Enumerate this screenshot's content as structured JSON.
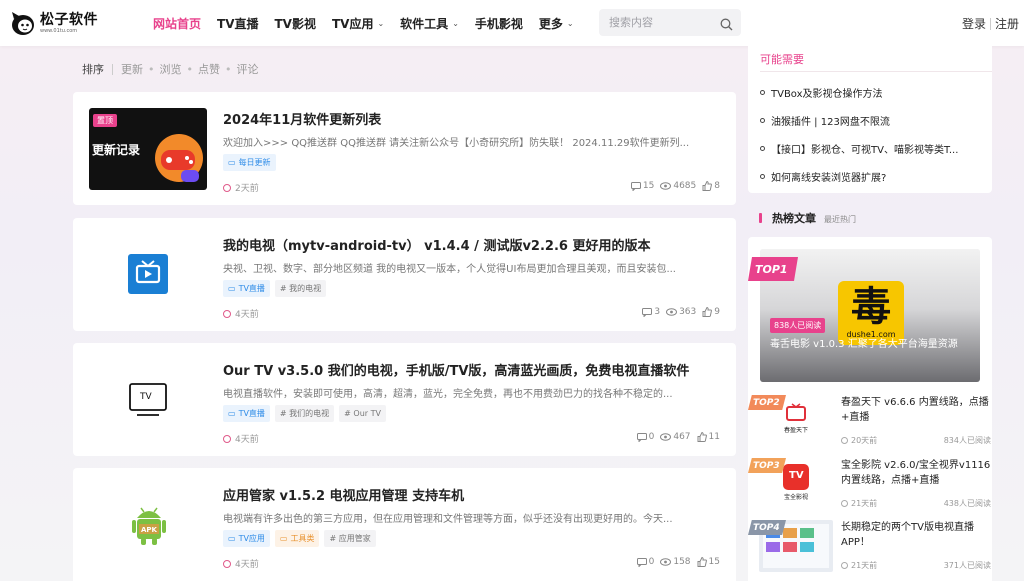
{
  "brand": {
    "name": "松子软件",
    "sub": "www.01tu.com"
  },
  "nav": {
    "items": [
      {
        "label": "网站首页",
        "active": true,
        "has_menu": false
      },
      {
        "label": "TV直播",
        "active": false,
        "has_menu": false
      },
      {
        "label": "TV影视",
        "active": false,
        "has_menu": false
      },
      {
        "label": "TV应用",
        "active": false,
        "has_menu": true
      },
      {
        "label": "软件工具",
        "active": false,
        "has_menu": true
      },
      {
        "label": "手机影视",
        "active": false,
        "has_menu": false
      },
      {
        "label": "更多",
        "active": false,
        "has_menu": true
      }
    ],
    "chevron": "⌄"
  },
  "search": {
    "placeholder": "搜索内容",
    "value": ""
  },
  "auth": {
    "login": "登录",
    "register": "注册"
  },
  "sort": {
    "label": "排序",
    "options": [
      "更新",
      "浏览",
      "点赞",
      "评论"
    ],
    "dot": "•"
  },
  "posts": [
    {
      "title": "2024年11月软件更新列表",
      "excerpt": "欢迎加入>>> QQ推送群 QQ推送群 请关注新公众号【小奇研究所】防失联！ 2024.11.29软件更新列...",
      "tags": [
        {
          "label": "每日更新",
          "style": "blue",
          "icon": "folder-icon"
        }
      ],
      "time": "2天前",
      "comments": "15",
      "views": "4685",
      "likes": "8",
      "thumb": {
        "badge": "置顶",
        "text": "更新记录"
      }
    },
    {
      "title": "我的电视（mytv-android-tv） v1.4.4 / 测试版v2.2.6 更好用的版本",
      "excerpt": "央视、卫视、数字、部分地区频道 我的电视又一版本，个人觉得UI布局更加合理且美观，而且安装包...",
      "tags": [
        {
          "label": "TV直播",
          "style": "blue",
          "icon": "folder-icon"
        },
        {
          "label": "# 我的电视",
          "style": "grey",
          "icon": ""
        }
      ],
      "time": "4天前",
      "comments": "3",
      "views": "363",
      "likes": "9"
    },
    {
      "title": "Our TV v3.5.0 我们的电视，手机版/TV版，高清蓝光画质，免费电视直播软件",
      "excerpt": "电视直播软件，安装即可使用，高清，超清，蓝光，完全免费，再也不用费劲巴力的找各种不稳定的...",
      "tags": [
        {
          "label": "TV直播",
          "style": "blue",
          "icon": "folder-icon"
        },
        {
          "label": "# 我们的电视",
          "style": "grey",
          "icon": ""
        },
        {
          "label": "# Our TV",
          "style": "grey",
          "icon": ""
        }
      ],
      "time": "4天前",
      "comments": "0",
      "views": "467",
      "likes": "11",
      "thumb": {
        "text": "TV"
      }
    },
    {
      "title": "应用管家 v1.5.2 电视应用管理 支持车机",
      "excerpt": "电视端有许多出色的第三方应用，但在应用管理和文件管理等方面，似乎还没有出现更好用的。今天...",
      "tags": [
        {
          "label": "TV应用",
          "style": "blue",
          "icon": "folder-icon"
        },
        {
          "label": "工具类",
          "style": "orange",
          "icon": "folder-icon"
        },
        {
          "label": "# 应用管家",
          "style": "grey",
          "icon": ""
        }
      ],
      "time": "4天前",
      "comments": "0",
      "views": "158",
      "likes": "15",
      "thumb": {
        "text": "APK"
      }
    }
  ],
  "sidebar": {
    "maybe": {
      "title": "可能需要",
      "items": [
        "TVBox及影视仓操作方法",
        "油猴插件 | 123网盘不限流",
        "【接口】影视仓、可视TV、喵影视等类T...",
        "如何离线安装浏览器扩展?"
      ]
    },
    "hot": {
      "title": "热榜文章",
      "subtitle": "最近热门",
      "top1": {
        "rank": "TOP1",
        "reads": "838人已阅读",
        "title": "毒舌电影 v1.0.3 汇聚了各大平台海量资源",
        "logo_text": "毒",
        "logo_sub": "dushe1.com"
      },
      "items": [
        {
          "rank": "TOP2",
          "title": "春盈天下 v6.6.6 内置线路，点播+直播",
          "time": "20天前",
          "reads": "834人已阅读",
          "color": "#f28a5a",
          "thumb_text": "春盈天下"
        },
        {
          "rank": "TOP3",
          "title": "宝全影院 v2.6.0/宝全视界v1116 内置线路，点播+直播",
          "time": "21天前",
          "reads": "438人已阅读",
          "color": "#f2a25a",
          "thumb_text": "宝全影视"
        },
        {
          "rank": "TOP4",
          "title": "长期稳定的两个TV版电视直播APP！",
          "time": "21天前",
          "reads": "371人已阅读",
          "color": "#8a96a8",
          "thumb_text": ""
        }
      ]
    }
  },
  "colors": {
    "accent": "#e8428c",
    "blue": "#2f8ce8",
    "orange": "#e8922f"
  }
}
